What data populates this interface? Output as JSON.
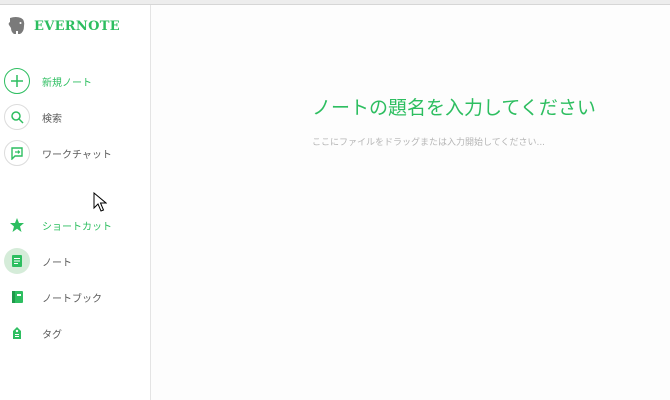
{
  "app": {
    "brand": "EVERNOTE",
    "accent_color": "#2dbe60"
  },
  "sidebar": {
    "actions": [
      {
        "label": "新規ノート",
        "icon": "plus-icon"
      },
      {
        "label": "検索",
        "icon": "search-icon"
      },
      {
        "label": "ワークチャット",
        "icon": "chat-icon"
      }
    ],
    "sections": [
      {
        "label": "ショートカット",
        "icon": "star-icon"
      },
      {
        "label": "ノート",
        "icon": "note-icon",
        "selected": true
      },
      {
        "label": "ノートブック",
        "icon": "notebook-icon"
      },
      {
        "label": "タグ",
        "icon": "tag-icon"
      }
    ]
  },
  "editor": {
    "title_placeholder": "ノートの題名を入力してください",
    "body_placeholder": "ここにファイルをドラッグまたは入力開始してください..."
  }
}
